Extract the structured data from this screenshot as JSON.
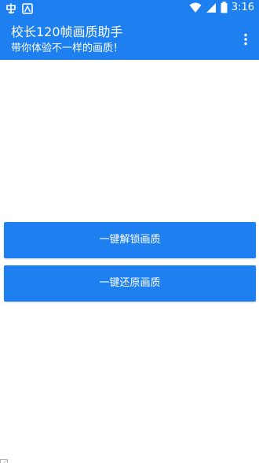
{
  "status_bar": {
    "time": "3:16",
    "left_icons": [
      "notification-app-icon",
      "photo-app-icon"
    ],
    "right_icons": [
      "wifi-icon",
      "cellular-icon",
      "battery-icon"
    ]
  },
  "app_bar": {
    "title": "校长120帧画质助手",
    "subtitle": "带你体验不一样的画质！",
    "menu_icon": "overflow-menu-icon"
  },
  "buttons": {
    "unlock_label": "一键解锁画质",
    "restore_label": "一键还原画质"
  },
  "colors": {
    "primary": "#1e7ff0",
    "text_on_primary": "#ffffff",
    "background": "#ffffff"
  }
}
